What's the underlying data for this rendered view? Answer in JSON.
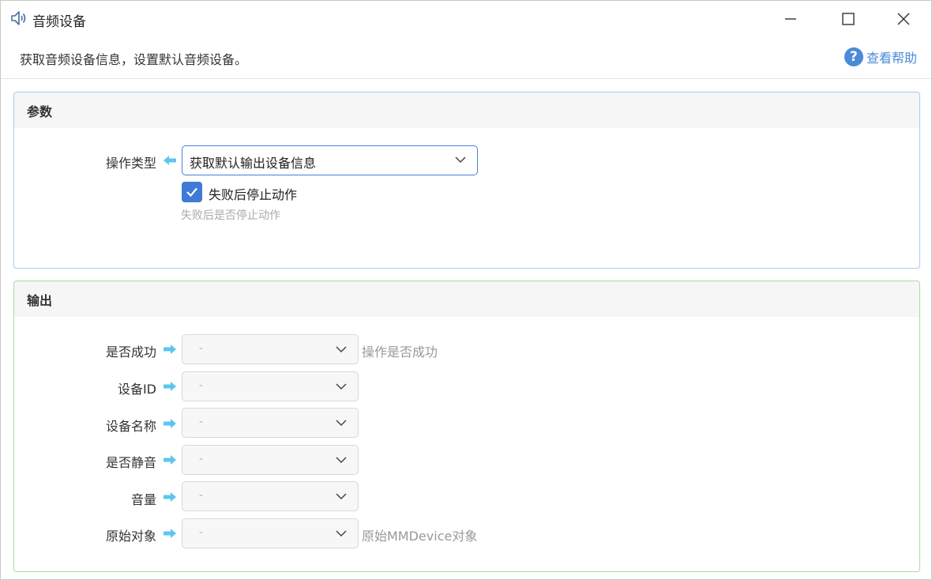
{
  "window": {
    "title": "音频设备",
    "title_icon": "speaker-icon",
    "controls": [
      "minimize-icon",
      "maximize-icon",
      "close-icon"
    ]
  },
  "description": "获取音频设备信息，设置默认音频设备。",
  "help": {
    "label": "查看帮助",
    "icon": "question-icon"
  },
  "params": {
    "section_title": "参数",
    "operation_type": {
      "label": "操作类型",
      "value": "获取默认输出设备信息"
    },
    "stop_on_fail": {
      "label": "失败后停止动作",
      "checked": true,
      "hint": "失败后是否停止动作"
    }
  },
  "output": {
    "section_title": "输出",
    "rows": [
      {
        "label": "是否成功",
        "value": "-",
        "hint": "操作是否成功"
      },
      {
        "label": "设备ID",
        "value": "-",
        "hint": ""
      },
      {
        "label": "设备名称",
        "value": "-",
        "hint": ""
      },
      {
        "label": "是否静音",
        "value": "-",
        "hint": ""
      },
      {
        "label": "音量",
        "value": "-",
        "hint": ""
      },
      {
        "label": "原始对象",
        "value": "-",
        "hint": "原始MMDevice对象"
      }
    ]
  },
  "colors": {
    "accent": "#4a80d9",
    "params_border": "#a9cdef",
    "output_border": "#a6dca0",
    "arrow": "#5cc6ef"
  }
}
